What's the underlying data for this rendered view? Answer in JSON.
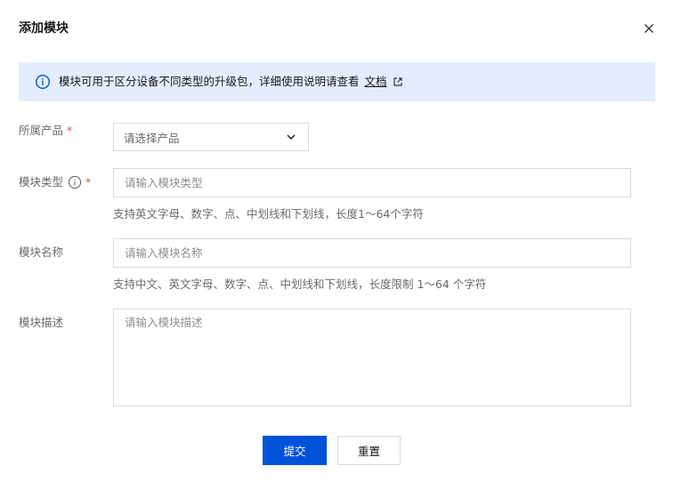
{
  "dialog": {
    "title": "添加模块"
  },
  "notice": {
    "text": "模块可用于区分设备不同类型的升级包，详细使用说明请查看",
    "link_label": "文档"
  },
  "form": {
    "product": {
      "label": "所属产品",
      "required_mark": "*",
      "placeholder": "请选择产品"
    },
    "module_type": {
      "label": "模块类型",
      "required_mark": "*",
      "placeholder": "请输入模块类型",
      "help": "支持英文字母、数字、点、中划线和下划线，长度1～64个字符"
    },
    "module_name": {
      "label": "模块名称",
      "placeholder": "请输入模块名称",
      "help": "支持中文、英文字母、数字、点、中划线和下划线，长度限制 1～64 个字符"
    },
    "module_desc": {
      "label": "模块描述",
      "placeholder": "请输入模块描述"
    }
  },
  "actions": {
    "submit_label": "提交",
    "reset_label": "重置"
  },
  "icons": {
    "close": "close-icon",
    "notice": "info-circle-icon",
    "external": "external-link-icon",
    "chevron": "chevron-down-icon",
    "help": "info-circle-icon"
  },
  "colors": {
    "primary": "#0052d9",
    "notice_bg": "#e4ecfd",
    "required": "#e54545",
    "border": "#dcdcdc"
  }
}
